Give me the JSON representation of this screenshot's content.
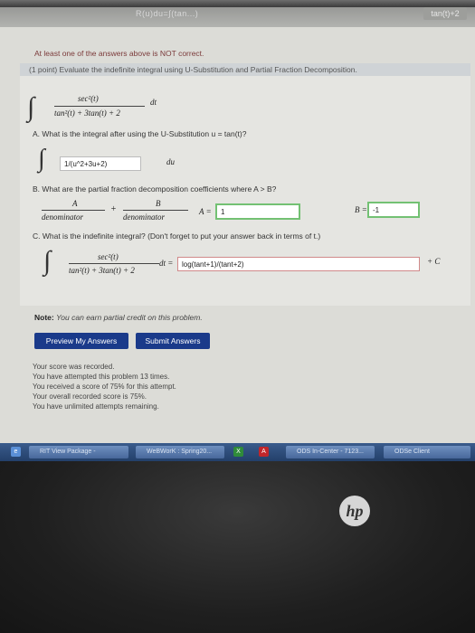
{
  "browser": {
    "top_center_text": "R(u)du=∫(tan...)",
    "top_right_text": "tan(t)+2"
  },
  "warning": "At least one of the answers above is NOT correct.",
  "problem": {
    "header": "(1 point) Evaluate the indefinite integral using U-Substitution and Partial Fraction Decomposition.",
    "numerator": "sec²(t)",
    "denominator": "tan²(t) + 3tan(t) + 2",
    "dt": "dt",
    "part_a_label": "A. What is the integral after using the U-Substitution u = tan(t)?",
    "part_a_value": "1/(u^2+3u+2)",
    "du": "du",
    "part_b_label": "B. What are the partial fraction decomposition coefficients where A > B?",
    "frac_a_num": "A",
    "frac_b_num": "B",
    "frac_den": "denominator",
    "plus": "+",
    "a_label": "A =",
    "a_value": "1",
    "b_label": "B =",
    "b_value": "-1",
    "part_c_label": "C. What is the indefinite integral? (Don't forget to put your answer back in terms of t.)",
    "c_eq": "dt =",
    "c_value": "log(tant+1)/(tant+2)",
    "plus_c": "+ C"
  },
  "note_bold": "Note:",
  "note_text": "You can earn partial credit on this problem.",
  "buttons": {
    "preview": "Preview My Answers",
    "submit": "Submit Answers"
  },
  "score_lines": [
    "Your score was recorded.",
    "You have attempted this problem 13 times.",
    "You received a score of 75% for this attempt.",
    "Your overall recorded score is 75%.",
    "You have unlimited attempts remaining."
  ],
  "taskbar": {
    "items": [
      "RIT View Package -",
      "WeBWorK : Spring20...",
      "ODS In-Center - 7123...",
      "ODSe Client"
    ]
  },
  "monitor": {
    "logo": "hp"
  }
}
